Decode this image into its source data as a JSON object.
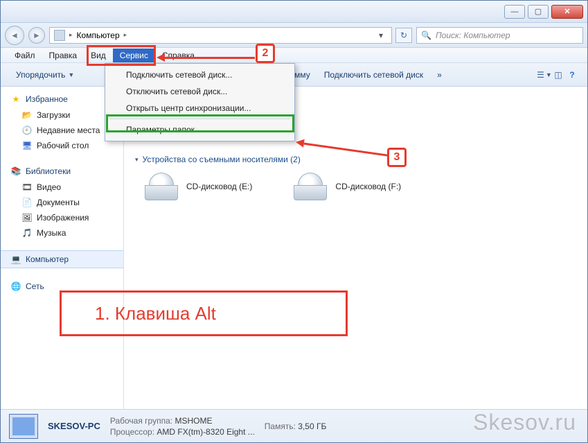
{
  "window_buttons": {
    "min": "—",
    "max": "▢",
    "close": "✕"
  },
  "breadcrumb": {
    "root_icon": "▸",
    "location": "Компьютер",
    "sep": "▸"
  },
  "search": {
    "placeholder": "Поиск: Компьютер"
  },
  "menubar": {
    "file": "Файл",
    "edit": "Правка",
    "view": "Вид",
    "tools": "Сервис",
    "help": "Справка"
  },
  "toolbar": {
    "organize": "Упорядочить",
    "uninstall": "Удалить или изменить программу",
    "uninstall_visible": "грамму",
    "map_drive": "Подключить сетевой диск",
    "chevron": "»"
  },
  "dropdown": {
    "map": "Подключить сетевой диск...",
    "unmap": "Отключить сетевой диск...",
    "sync": "Открыть центр синхронизации...",
    "folder_options": "Параметры папок..."
  },
  "navpane": {
    "favorites": "Избранное",
    "downloads": "Загрузки",
    "recent": "Недавние места",
    "desktop": "Рабочий стол",
    "libraries": "Библиотеки",
    "videos": "Видео",
    "documents": "Документы",
    "pictures": "Изображения",
    "music": "Музыка",
    "computer": "Компьютер",
    "network": "Сеть"
  },
  "content": {
    "removable_header": "Устройства со съемными носителями (2)",
    "drive_e": "CD-дисковод (E:)",
    "drive_f": "CD-дисковод (F:)"
  },
  "details": {
    "pc_name": "SKESOV-PC",
    "workgroup_label": "Рабочая группа:",
    "workgroup": "MSHOME",
    "cpu_label": "Процессор:",
    "cpu": "AMD FX(tm)-8320 Eight ...",
    "mem_label": "Память:",
    "mem": "3,50 ГБ"
  },
  "annotations": {
    "step1": "1. Клавиша Alt",
    "step2": "2",
    "step3": "3"
  },
  "watermark": "Skesov.ru"
}
